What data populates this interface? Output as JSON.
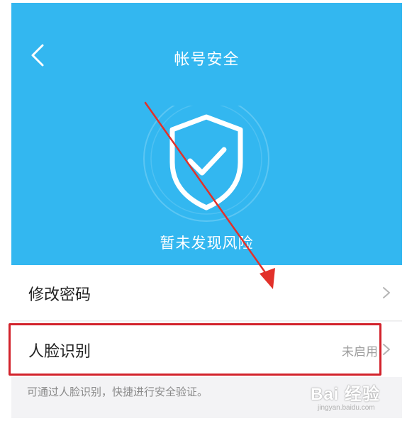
{
  "header": {
    "title": "帐号安全",
    "back_icon": "chevron-left-icon"
  },
  "hero": {
    "status_text": "暂未发现风险",
    "shield_icon": "shield-check-icon",
    "background_color": "#33b7f0"
  },
  "settings": {
    "items": [
      {
        "label": "修改密码",
        "value": "",
        "icon": "chevron-right-icon"
      },
      {
        "label": "人脸识别",
        "value": "未启用",
        "icon": "chevron-right-icon"
      }
    ],
    "hint": "可通过人脸识别，快捷进行安全验证。"
  },
  "annotation": {
    "highlight_color": "#d2222b"
  },
  "watermark": {
    "text": "Bai 经验",
    "subtext": "jingyan.baidu.com"
  }
}
